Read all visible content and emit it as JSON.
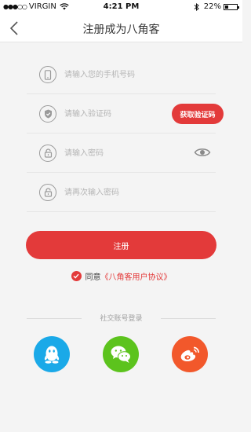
{
  "status_bar": {
    "signal": "●●●○○",
    "carrier": "VIRGIN",
    "time": "4:21 PM",
    "battery": "22%"
  },
  "nav": {
    "title": "注册成为八角客"
  },
  "form": {
    "phone_placeholder": "请输入您的手机号码",
    "code_placeholder": "请输入验证码",
    "get_code_label": "获取验证码",
    "password_placeholder": "请输入密码",
    "confirm_placeholder": "请再次输入密码"
  },
  "register_label": "注册",
  "agreement": {
    "prefix": "同意",
    "link": "《八角客用户协议》"
  },
  "social": {
    "label": "社交账号登录",
    "items": [
      "qq-icon",
      "wechat-icon",
      "weibo-icon"
    ]
  },
  "colors": {
    "accent": "#e33a3a",
    "qq": "#1aa9e8",
    "wechat": "#5cc31d",
    "weibo": "#f2582b"
  }
}
